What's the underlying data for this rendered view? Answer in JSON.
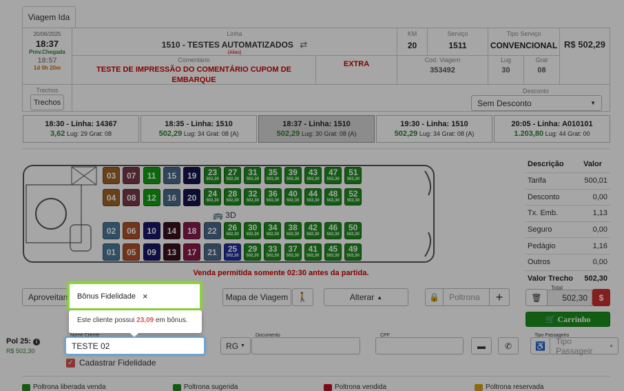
{
  "tab": "Viagem Ida",
  "header": {
    "date": "20/06/2025",
    "time": "18:37",
    "prev_label": "Prev.Chegada",
    "prev_time": "18:57",
    "duration": "1d 0h 20m",
    "linha_label": "Linha",
    "linha": "1510 - TESTES AUTOMATIZADOS",
    "alias": "(Alias)",
    "km_label": "KM",
    "km": "20",
    "servico_label": "Serviço",
    "servico": "1511",
    "tipo_servico_label": "Tipo Serviço",
    "tipo_servico": "CONVENCIONAL",
    "total": "R$ 502,29",
    "comentario_label": "Comentário",
    "comentario": "TESTE DE IMPRESSÃO DO COMENTÁRIO CUPOM DE EMBARQUE",
    "extra": "EXTRA",
    "cod_viagem_label": "Cod. Viagem",
    "cod_viagem": "353492",
    "lug_label": "Lug",
    "lug": "30",
    "grat_label": "Grat",
    "grat": "08",
    "trechos_label": "Trechos",
    "trechos_btn": "Trechos",
    "desconto_label": "Desconto",
    "desconto": "Sem Desconto"
  },
  "trips": [
    {
      "title": "18:30 - Linha: 14367",
      "price": "3,62",
      "info": "Lug: 29 Grat: 08"
    },
    {
      "title": "18:35 - Linha: 1510",
      "price": "502,29",
      "info": "Lug: 34 Grat: 08 (A)"
    },
    {
      "title": "18:37 - Linha: 1510",
      "price": "502,29",
      "info": "Lug: 30 Grat: 08 (A)"
    },
    {
      "title": "19:30 - Linha: 1510",
      "price": "502,29",
      "info": "Lug: 34 Grat: 08 (A)"
    },
    {
      "title": "20:05 - Linha: A010101",
      "price": "1.203,80",
      "info": "Lug: 44 Grat: 00"
    }
  ],
  "seat_price": "502,30",
  "seats_small": [
    "03",
    "07",
    "11",
    "15",
    "19",
    "04",
    "08",
    "12",
    "16",
    "20",
    "02",
    "06",
    "10",
    "14",
    "18",
    "22",
    "01",
    "05",
    "09",
    "13",
    "17",
    "21"
  ],
  "seats_row1": [
    "23",
    "27",
    "31",
    "35",
    "39",
    "43",
    "47",
    "51"
  ],
  "seats_row2": [
    "24",
    "28",
    "32",
    "36",
    "40",
    "44",
    "48",
    "52"
  ],
  "seats_row3": [
    "26",
    "30",
    "34",
    "38",
    "42",
    "46",
    "50"
  ],
  "seats_row4": [
    "25",
    "29",
    "33",
    "37",
    "41",
    "45",
    "49"
  ],
  "bus_label": "3D",
  "sale_warning": "Venda permitida somente 02:30 antes da partida.",
  "prices": {
    "desc_header": "Descrição",
    "val_header": "Valor",
    "rows": [
      {
        "label": "Tarifa",
        "value": "500,01"
      },
      {
        "label": "Desconto",
        "value": "0,00"
      },
      {
        "label": "Tx. Emb.",
        "value": "1,13"
      },
      {
        "label": "Seguro",
        "value": "0,00"
      },
      {
        "label": "Pedágio",
        "value": "1,16"
      },
      {
        "label": "Outros",
        "value": "0,00"
      }
    ],
    "valor_trecho_label": "Valor Trecho",
    "valor_trecho": "502,30"
  },
  "actions": {
    "aproveitamento": "Aproveitame",
    "mapa": "Mapa de Viagem",
    "alterar": "Alterar",
    "poltrona_placeholder": "Poltrona",
    "total_label": "Total",
    "total": "502,30",
    "carrinho": "Carrinho"
  },
  "popover": {
    "title": "Bônus Fidelidade",
    "text_before": "Este cliente possui",
    "amount": "23,09",
    "text_after": "em bônus."
  },
  "passenger": {
    "pol": "Pol 25:",
    "pol_price": "R$ 502,30",
    "nome_label": "Nome Cliente",
    "nome": "TESTE 02",
    "doc_type": "RG",
    "documento_label": "Documento",
    "cpf_label": "CPF",
    "tipo_label": "Tipo Passageiro",
    "tipo": "Tipo Passageir",
    "fidelidade": "Cadastrar Fidelidade"
  },
  "legend": [
    {
      "label": "Poltrona liberada venda",
      "color": "#1e8c1e"
    },
    {
      "label": "Poltrona sugerida",
      "color": "#1e8c1e"
    },
    {
      "label": "Poltrona vendida",
      "color": "#c0102a"
    },
    {
      "label": "Poltrona reservada",
      "color": "#d4a514"
    }
  ]
}
